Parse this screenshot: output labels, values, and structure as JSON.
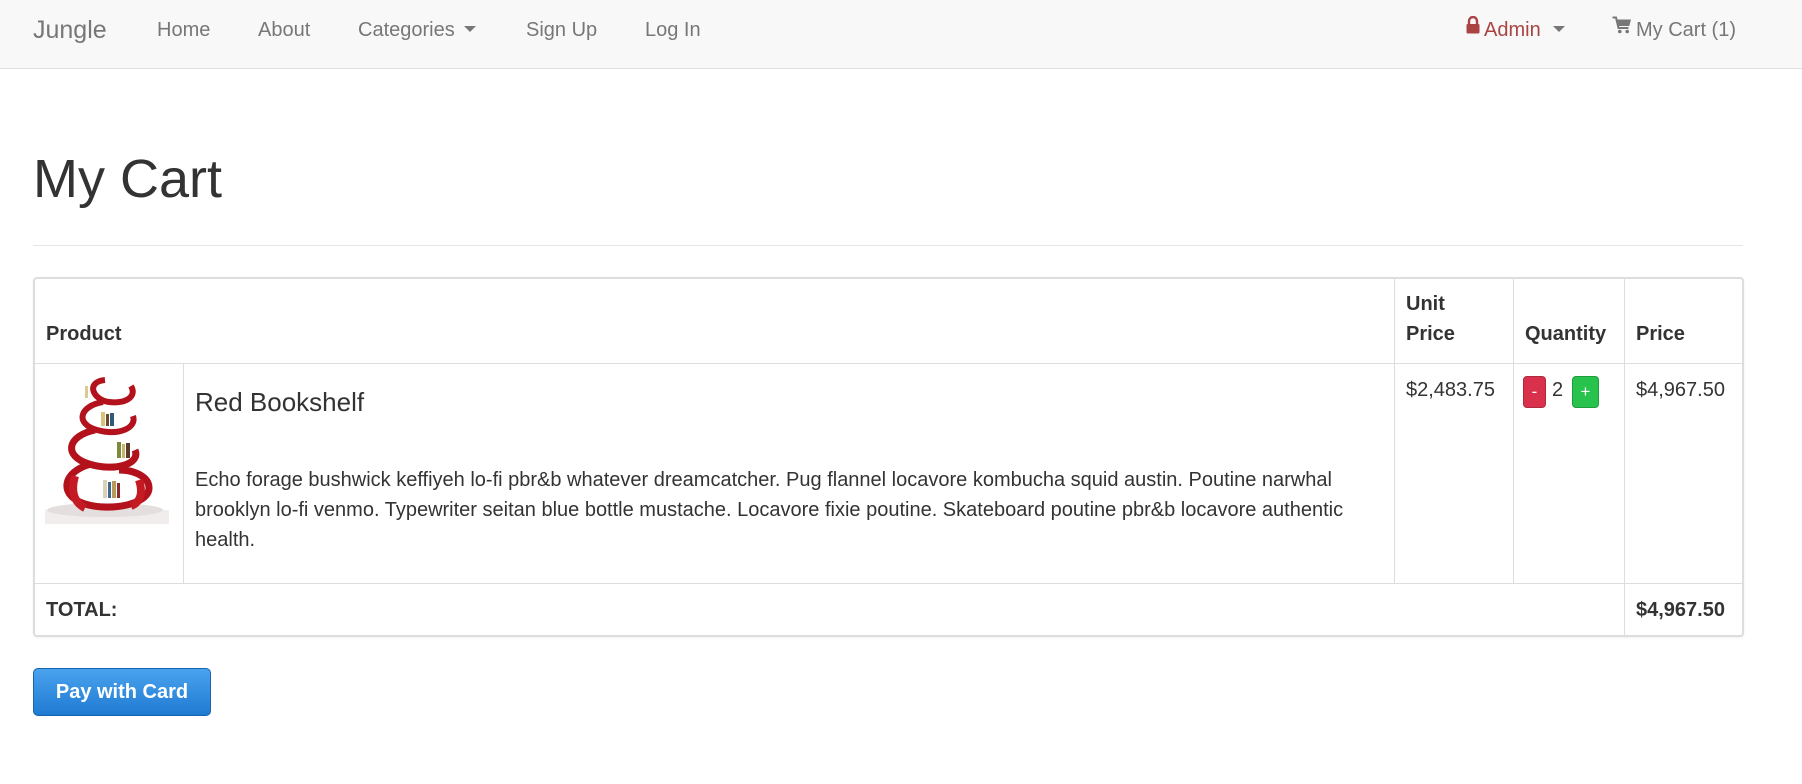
{
  "navbar": {
    "brand": "Jungle",
    "links": {
      "home": "Home",
      "about": "About",
      "categories": "Categories",
      "signup": "Sign Up",
      "login": "Log In"
    },
    "admin_label": "Admin",
    "cart_label": "My Cart (1)"
  },
  "page": {
    "title": "My Cart"
  },
  "table": {
    "headers": {
      "product": "Product",
      "unit_price_line1": "Unit",
      "unit_price_line2": "Price",
      "quantity": "Quantity",
      "price": "Price"
    },
    "rows": [
      {
        "name": "Red Bookshelf",
        "description": "Echo forage bushwick keffiyeh lo-fi pbr&b whatever dreamcatcher. Pug flannel locavore kombucha squid austin. Poutine narwhal brooklyn lo-fi venmo. Typewriter seitan blue bottle mustache. Locavore fixie poutine. Skateboard poutine pbr&b locavore authentic health.",
        "unit_price": "$2,483.75",
        "quantity": "2",
        "minus_label": "-",
        "plus_label": "+",
        "price": "$4,967.50"
      }
    ],
    "total_label": "TOTAL:",
    "total_value": "$4,967.50"
  },
  "actions": {
    "pay_label": "Pay with Card"
  },
  "colors": {
    "navbar_bg": "#f8f8f8",
    "admin_text": "#a94442",
    "minus_button": "#d9304c",
    "plus_button": "#27c34c",
    "pay_button": "#1f7ad2"
  },
  "icons": {
    "admin": "lock-icon",
    "cart": "shopping-cart-icon"
  }
}
